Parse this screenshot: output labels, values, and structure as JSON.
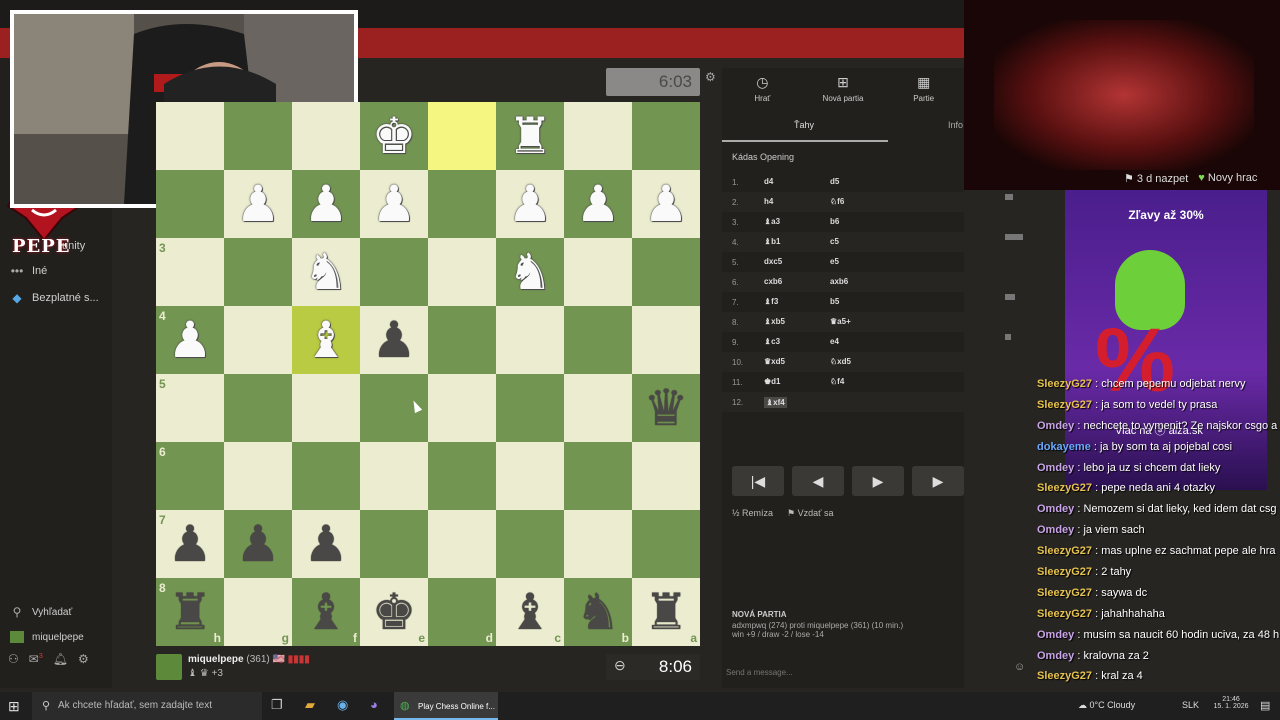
{
  "sidebar": {
    "community_suffix": "unity",
    "brand": "PEPE",
    "items": [
      {
        "icon": "more-dots-icon",
        "glyph": "•••",
        "label": "Iné"
      },
      {
        "icon": "diamond-icon",
        "glyph": "◆",
        "label": "Bezplatné s..."
      }
    ],
    "search": {
      "glyph": "⚲",
      "label": "Vyhľadať"
    },
    "user": {
      "label": "miquelpepe"
    },
    "notification_count": "3"
  },
  "opponent_clock": "6:03",
  "board": {
    "rows": [
      [
        "",
        "",
        "",
        "WK",
        "",
        "WR",
        "",
        ""
      ],
      [
        "",
        "WP",
        "WP",
        "WP",
        "",
        "WP",
        "WP",
        "WP"
      ],
      [
        "",
        "",
        "WN",
        "",
        "",
        "WN",
        "",
        ""
      ],
      [
        "WP",
        "",
        "WB",
        "BP",
        "",
        "",
        "",
        ""
      ],
      [
        "",
        "",
        "",
        "",
        "",
        "",
        "",
        "BQ"
      ],
      [
        "",
        "",
        "",
        "",
        "",
        "",
        "",
        ""
      ],
      [
        "BP",
        "BP",
        "BP",
        "",
        "",
        "",
        "",
        ""
      ],
      [
        "BR",
        "",
        "BB",
        "BK",
        "",
        "BB",
        "BN",
        "BR"
      ]
    ],
    "highlight": [
      [
        0,
        4
      ],
      [
        3,
        2
      ]
    ],
    "rank_labels": [
      "",
      "",
      "3",
      "4",
      "5",
      "6",
      "7",
      "8"
    ],
    "file_labels": [
      "h",
      "g",
      "f",
      "e",
      "d",
      "c",
      "b",
      "a"
    ]
  },
  "player": {
    "name": "miquelpepe",
    "rating": "(361)",
    "flag": "🇺🇸 ▮▮▮▮",
    "captured": "♝ ♛ +3",
    "clock": "8:06",
    "clock_icon": "⊖"
  },
  "panel": {
    "tabs": [
      {
        "glyph": "◷",
        "label": "Hrať"
      },
      {
        "glyph": "⊞",
        "label": "Nová partia"
      },
      {
        "glyph": "▦",
        "label": "Partie"
      }
    ],
    "subtab_moves": "Ťahy",
    "subtab_info": "Info",
    "opening": "Kádas Opening",
    "moves": [
      {
        "n": "1.",
        "w": "d4",
        "b": "d5"
      },
      {
        "n": "2.",
        "w": "h4",
        "b": "♘f6"
      },
      {
        "n": "3.",
        "w": "♝a3",
        "b": "b6"
      },
      {
        "n": "4.",
        "w": "♝b1",
        "b": "c5"
      },
      {
        "n": "5.",
        "w": "dxc5",
        "b": "e5"
      },
      {
        "n": "6.",
        "w": "cxb6",
        "b": "axb6"
      },
      {
        "n": "7.",
        "w": "♝f3",
        "b": "b5"
      },
      {
        "n": "8.",
        "w": "♝xb5",
        "b": "♛a5+"
      },
      {
        "n": "9.",
        "w": "♝c3",
        "b": "e4"
      },
      {
        "n": "10.",
        "w": "♛xd5",
        "b": "♘xd5"
      },
      {
        "n": "11.",
        "w": "♚d1",
        "b": "♘f4"
      },
      {
        "n": "12.",
        "w": "♝xf4",
        "b": ""
      }
    ],
    "nav": [
      "|◀",
      "◀",
      "▶",
      "▶",
      "▶|"
    ],
    "draw_label": "Remíza",
    "resign_label": "Vzdať sa",
    "new_game_title": "NOVÁ PARTIA",
    "new_game_line1": "adxmpwq (274) proti miquelpepe (361) (10 min.)",
    "new_game_line2": "win +9 / draw -2 / lose -14",
    "message_placeholder": "Send a message..."
  },
  "stream": {
    "stats_follow": "3 d nazpet",
    "stats_player": "Novy hrac"
  },
  "ad": {
    "title": "Zľavy až 30%",
    "percent": "%",
    "link": "Viac na ⓐ alza.sk"
  },
  "chat": [
    {
      "user": "SleezyG27",
      "color": "#e6c24f",
      "text": "chcem pepemu odjebat nervy"
    },
    {
      "user": "SleezyG27",
      "color": "#e6c24f",
      "text": "ja som to vedel ty prasa"
    },
    {
      "user": "Omdey",
      "color": "#c9a4e8",
      "text": "nechcete to vymenit? Ze najskor csgo a"
    },
    {
      "user": "dokayeme",
      "color": "#6aa9ff",
      "text": "ja by som ta aj pojebal cosi"
    },
    {
      "user": "Omdey",
      "color": "#c9a4e8",
      "text": "lebo ja uz si chcem dat lieky"
    },
    {
      "user": "SleezyG27",
      "color": "#e6c24f",
      "text": "pepe neda ani 4 otazky"
    },
    {
      "user": "Omdey",
      "color": "#c9a4e8",
      "text": "Nemozem si dat lieky, ked idem dat csg"
    },
    {
      "user": "Omdey",
      "color": "#c9a4e8",
      "text": "ja viem sach"
    },
    {
      "user": "SleezyG27",
      "color": "#e6c24f",
      "text": "mas uplne ez sachmat pepe ale hra"
    },
    {
      "user": "SleezyG27",
      "color": "#e6c24f",
      "text": "2 tahy"
    },
    {
      "user": "SleezyG27",
      "color": "#e6c24f",
      "text": "saywa dc"
    },
    {
      "user": "SleezyG27",
      "color": "#e6c24f",
      "text": "jahahhahaha"
    },
    {
      "user": "Omdey",
      "color": "#c9a4e8",
      "text": "musim sa naucit 60 hodin uciva, za 48 h"
    },
    {
      "user": "Omdey",
      "color": "#c9a4e8",
      "text": "kralovna za 2"
    },
    {
      "user": "SleezyG27",
      "color": "#e6c24f",
      "text": "kral za 4"
    }
  ],
  "taskbar": {
    "search_placeholder": "Ak chcete hľadať, sem zadajte text",
    "app_label": "Play Chess Online f...",
    "weather": "0°C Cloudy",
    "lang": "SLK",
    "time": "21:46",
    "date": "15. 1. 2026"
  }
}
